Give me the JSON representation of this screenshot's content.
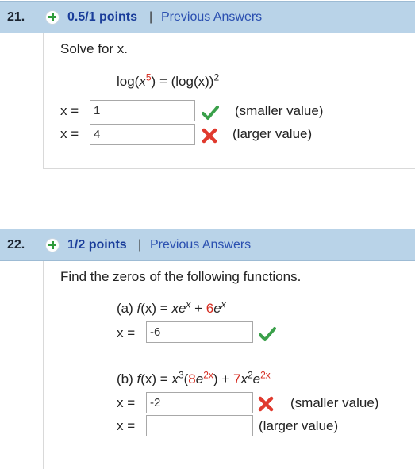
{
  "q21": {
    "number": "21.",
    "points": "0.5/1 points",
    "separator": "|",
    "previous_answers": "Previous Answers",
    "prompt": "Solve for x.",
    "eq": {
      "lhs_open": "log(",
      "x": "x",
      "exp5": "5",
      "lhs_close": ")",
      "eqsign": " = ",
      "rhs": "(log(x))",
      "exp2": "2"
    },
    "row1": {
      "label": "x =",
      "value": "1",
      "hint": "(smaller value)"
    },
    "row2": {
      "label": "x =",
      "value": "4",
      "hint": "(larger value)"
    }
  },
  "q22": {
    "number": "22.",
    "points": "1/2 points",
    "separator": "|",
    "previous_answers": "Previous Answers",
    "prompt": "Find the zeros of the following functions.",
    "part_a": {
      "eq": {
        "pre": "(a) ",
        "f": "f",
        "open": "(x) = ",
        "xe": "xe",
        "sup_x": "x",
        "plus": " + ",
        "six": "6",
        "e": "e",
        "sup_x2": "x"
      },
      "label": "x =",
      "value": "-6"
    },
    "part_b": {
      "eq": {
        "pre": "(b) ",
        "f": "f",
        "open": "(x) = ",
        "x": "x",
        "sup3": "3",
        "lp": "(",
        "eight": "8",
        "e": "e",
        "sup2x": "2x",
        "rp": ")",
        "plus": " + ",
        "seven": "7",
        "x2": "x",
        "sup2": "2",
        "e2": "e",
        "sup2x_b": "2x"
      },
      "row1": {
        "label": "x =",
        "value": "-2",
        "hint": "(smaller value)"
      },
      "row2": {
        "label": "x =",
        "value": "",
        "hint": "(larger value)"
      }
    }
  },
  "colors": {
    "header_bg": "#b9d3e8",
    "points_text": "#1a3d9a",
    "link": "#2a4fb0",
    "red": "#d42a1e",
    "check": "#3aa04a",
    "cross": "#e03a2e"
  },
  "icons": {
    "plus": "green-plus-icon",
    "correct": "check-icon",
    "wrong": "cross-icon"
  }
}
